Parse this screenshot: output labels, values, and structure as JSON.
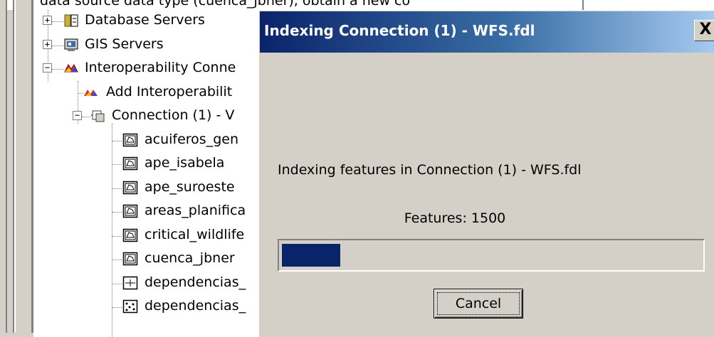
{
  "top_strip": {
    "partial_text": "data source data type (cuenca_jbner), obtain a new co"
  },
  "tree": {
    "items": [
      {
        "label": "Database Servers",
        "icon": "database-servers-icon",
        "expander": "+",
        "level": 0
      },
      {
        "label": "GIS Servers",
        "icon": "gis-servers-icon",
        "expander": "+",
        "level": 0
      },
      {
        "label": "Interoperability Conne",
        "icon": "interoperability-icon",
        "expander": "−",
        "level": 0
      },
      {
        "label": "Add Interoperabilit",
        "icon": "add-interoperability-icon",
        "expander": "",
        "level": 1
      },
      {
        "label": "Connection (1) -  V",
        "icon": "connection-icon",
        "expander": "−",
        "level": 1
      },
      {
        "label": "acuiferos_gen",
        "icon": "polygon-layer-icon",
        "expander": "",
        "level": 2
      },
      {
        "label": "ape_isabela",
        "icon": "polygon-layer-icon",
        "expander": "",
        "level": 2
      },
      {
        "label": "ape_suroeste",
        "icon": "polygon-layer-icon",
        "expander": "",
        "level": 2
      },
      {
        "label": "areas_planifica",
        "icon": "polygon-layer-icon",
        "expander": "",
        "level": 2
      },
      {
        "label": "critical_wildlife",
        "icon": "polygon-layer-icon",
        "expander": "",
        "level": 2
      },
      {
        "label": "cuenca_jbner",
        "icon": "polygon-layer-icon",
        "expander": "",
        "level": 2
      },
      {
        "label": "dependencias_",
        "icon": "line-layer-icon",
        "expander": "",
        "level": 2
      },
      {
        "label": "dependencias_",
        "icon": "point-layer-icon",
        "expander": "",
        "level": 2
      }
    ]
  },
  "dialog": {
    "title": "Indexing Connection (1) -  WFS.fdl",
    "close_label": "X",
    "message": "Indexing features in Connection (1) -  WFS.fdl",
    "features_text": "Features: 1500",
    "progress_fraction": 0.14,
    "cancel_label": "Cancel"
  },
  "colors": {
    "title_start": "#0a246a",
    "title_end": "#a6caf0",
    "progress_fill": "#0a246a",
    "face": "#d4d0c8"
  }
}
